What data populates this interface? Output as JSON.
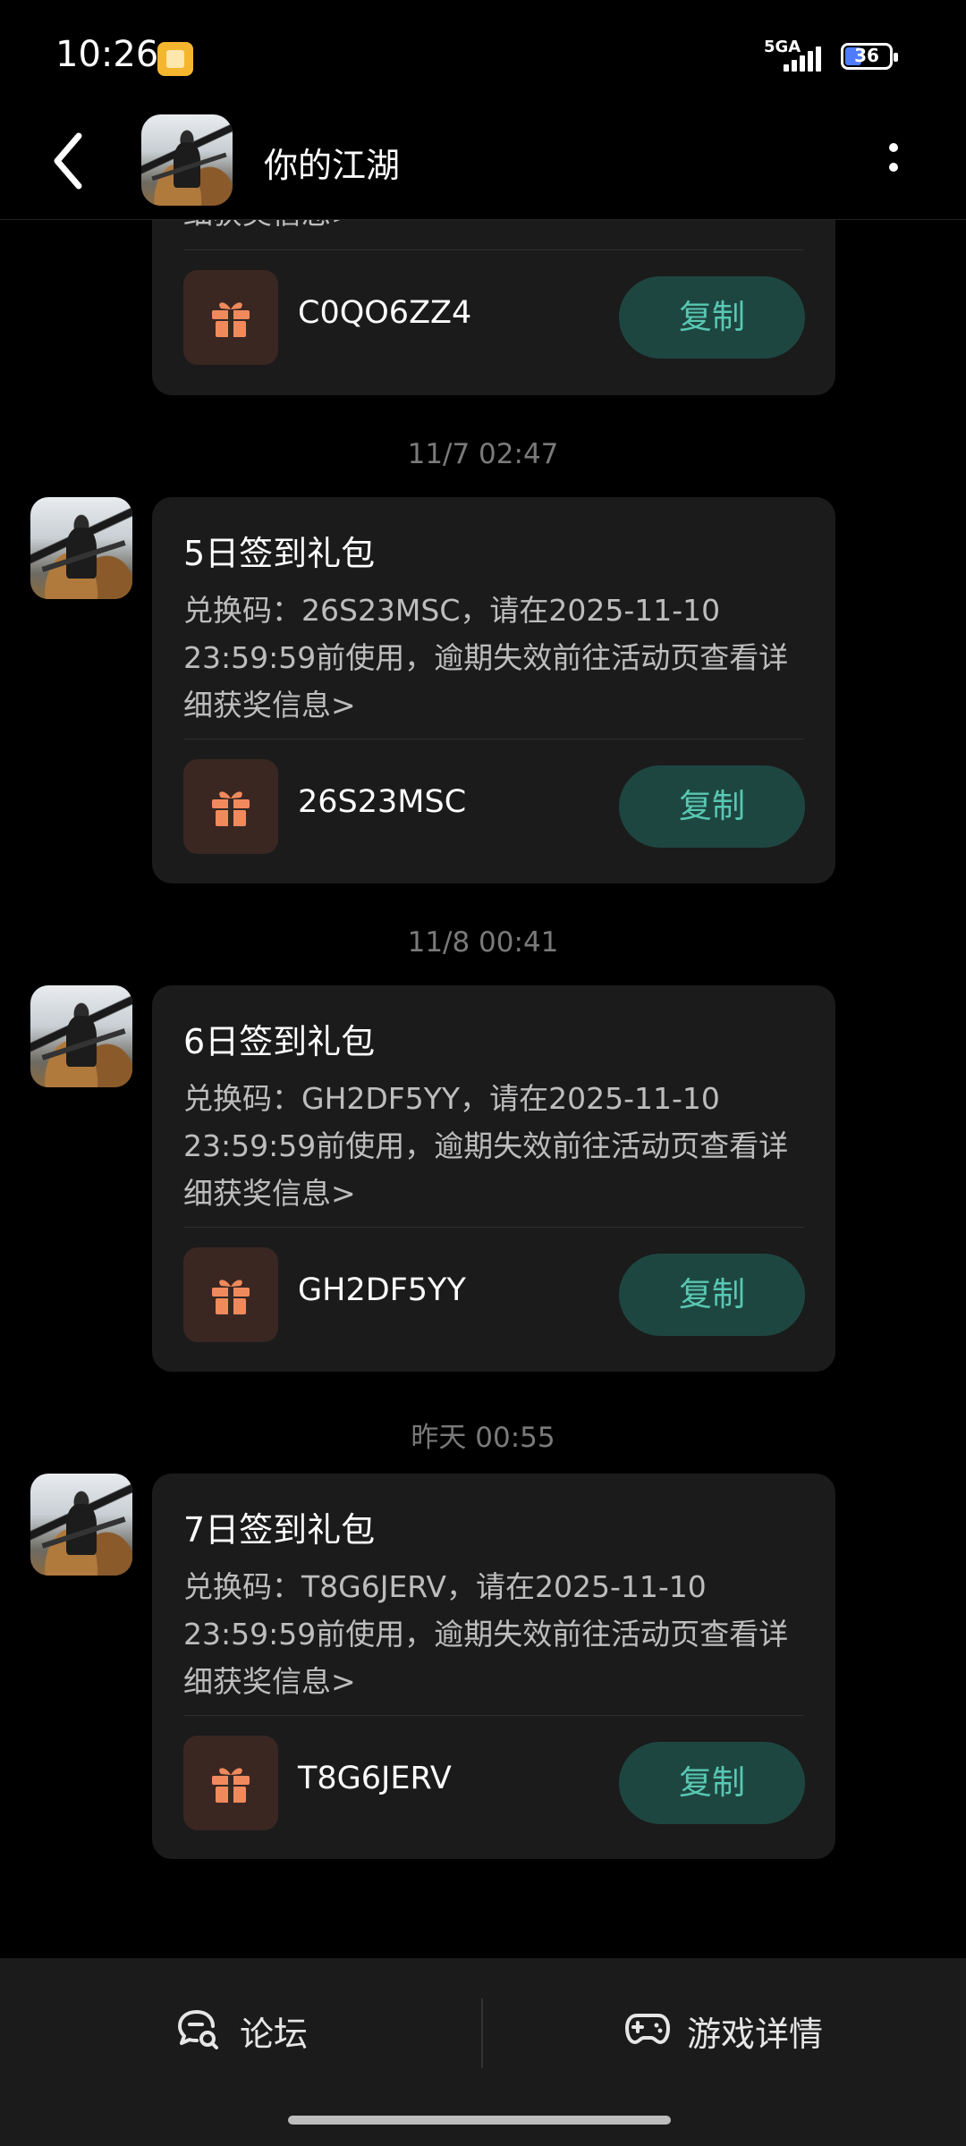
{
  "status_bar": {
    "time": "10:26",
    "network": "5GA",
    "battery": "36"
  },
  "header": {
    "title": "你的江湖"
  },
  "messages": [
    {
      "code": "C0QO6ZZ4",
      "copy_label": "复制",
      "partial_text": "细获奖信息>"
    },
    {
      "timestamp": "11/7  02:47",
      "title": "5日签到礼包",
      "body": "兑换码：26S23MSC，请在2025-11-10 23:59:59前使用，逾期失效前往活动页查看详细获奖信息>",
      "code": "26S23MSC",
      "copy_label": "复制"
    },
    {
      "timestamp": "11/8  00:41",
      "title": "6日签到礼包",
      "body": "兑换码：GH2DF5YY，请在2025-11-10 23:59:59前使用，逾期失效前往活动页查看详细获奖信息>",
      "code": "GH2DF5YY",
      "copy_label": "复制"
    },
    {
      "timestamp": "昨天  00:55",
      "title": "7日签到礼包",
      "body": "兑换码：T8G6JERV，请在2025-11-10 23:59:59前使用，逾期失效前往活动页查看详细获奖信息>",
      "code": "T8G6JERV",
      "copy_label": "复制"
    }
  ],
  "bottom_bar": {
    "forum_label": "论坛",
    "game_details_label": "游戏详情"
  },
  "colors": {
    "background": "#000000",
    "card": "#1b1b1b",
    "copy_button_bg": "#1e4640",
    "copy_button_text": "#58c8b3",
    "gift_icon": "#f08a5d"
  }
}
